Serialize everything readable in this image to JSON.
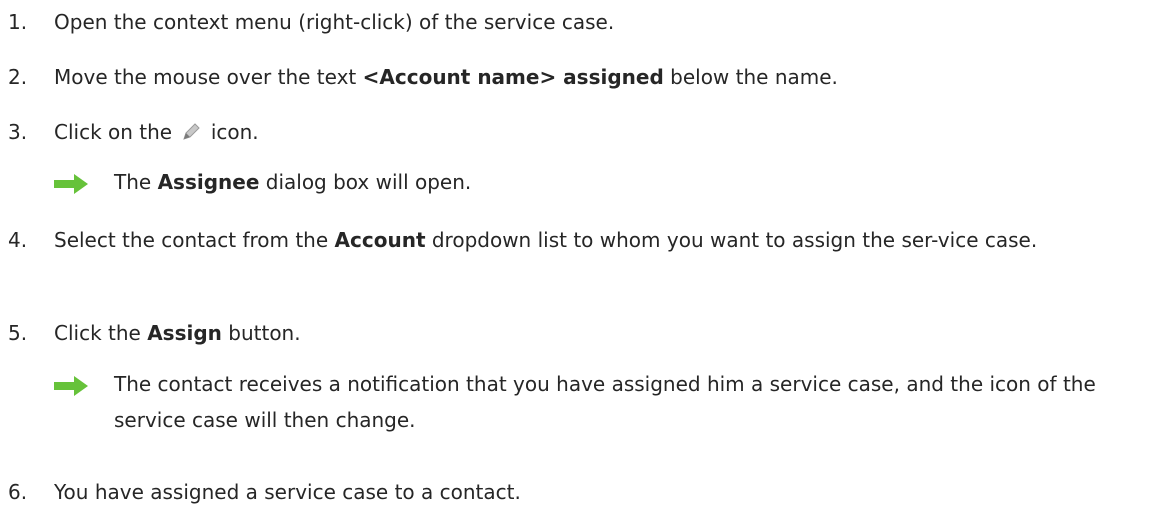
{
  "steps": [
    {
      "num": "1.",
      "parts": [
        "Open the context menu (right-click) of the service case."
      ]
    },
    {
      "num": "2.",
      "pre": "Move the mouse over the text ",
      "bold": "<Account name> assigned",
      "post": " below the name."
    },
    {
      "num": "3.",
      "pre": "Click on the ",
      "icon": "pencil-icon",
      "post": " icon."
    },
    {
      "num": "4.",
      "pre": "Select the contact from the ",
      "bold": "Account",
      "post": " dropdown list to whom you want to assign the ser-vice case."
    },
    {
      "num": "5.",
      "pre": "Click the ",
      "bold": "Assign",
      "post": " button."
    },
    {
      "num": "6.",
      "parts": [
        "You have assigned a service case to a contact."
      ]
    }
  ],
  "results": [
    {
      "icon": "green-arrow-icon",
      "pre": "The ",
      "bold": "Assignee",
      "post": " dialog box will open."
    },
    {
      "icon": "green-arrow-icon",
      "text": "The contact receives a notification that you have assigned him a service case, and the icon of the service case will then change."
    }
  ],
  "colors": {
    "arrow": "#66c23a",
    "text": "#262626"
  }
}
